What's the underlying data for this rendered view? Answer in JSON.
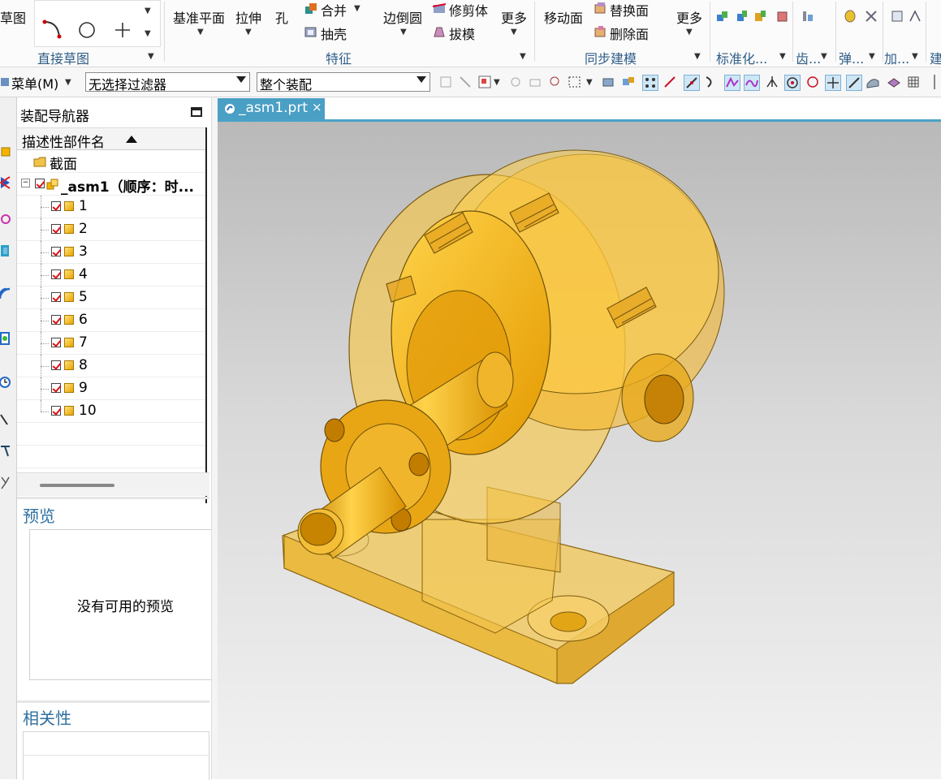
{
  "ribbon": {
    "sketch_label": "草图",
    "direct_sketch_group": "直接草图",
    "datum_plane": "基准平面",
    "extrude": "拉伸",
    "hole": "孔",
    "unite": "合并",
    "shell": "抽壳",
    "edge_blend": "边倒圆",
    "trim_body": "修剪体",
    "draft": "拔模",
    "more_feature": "更多",
    "feature_group": "特征",
    "move_face": "移动面",
    "replace_face": "替换面",
    "delete_face": "删除面",
    "more_sync": "更多",
    "sync_group": "同步建模",
    "standard_group": "标准化...",
    "gear_group": "齿...",
    "spring_group": "弹...",
    "add_group": "加...",
    "build_group": "建"
  },
  "toolbar": {
    "menu_label": "菜单(M)",
    "selection_filter": "无选择过滤器",
    "scope": "整个装配"
  },
  "navigator": {
    "title": "装配导航器",
    "column_header": "描述性部件名",
    "section_node": "截面",
    "root_node": "_asm1（顺序：时...",
    "parts": [
      "1",
      "2",
      "3",
      "4",
      "5",
      "6",
      "7",
      "8",
      "9",
      "10"
    ],
    "preview_title": "预览",
    "preview_empty": "没有可用的预览",
    "relevance_title": "相关性"
  },
  "viewport": {
    "tab_label": "_asm1.prt",
    "tab_close": "×"
  },
  "colors": {
    "accent": "#4a9fc4",
    "group_label": "#2f5d87",
    "part_gold": "#f2b400"
  }
}
